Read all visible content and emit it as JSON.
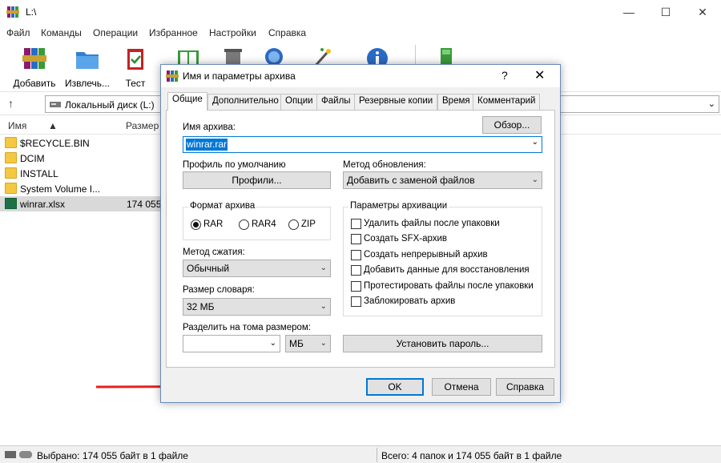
{
  "window": {
    "title": "L:\\"
  },
  "menu": [
    "Файл",
    "Команды",
    "Операции",
    "Избранное",
    "Настройки",
    "Справка"
  ],
  "toolbar": {
    "buttons": [
      "Добавить",
      "Извлечь...",
      "Тест"
    ]
  },
  "address": {
    "path": "Локальный диск (L:)"
  },
  "columns": {
    "name": "Имя",
    "size": "Размер"
  },
  "files": [
    {
      "name": "$RECYCLE.BIN",
      "size": "",
      "type": "folder"
    },
    {
      "name": "DCIM",
      "size": "",
      "type": "folder"
    },
    {
      "name": "INSTALL",
      "size": "",
      "type": "folder"
    },
    {
      "name": "System Volume I...",
      "size": "",
      "type": "folder"
    },
    {
      "name": "winrar.xlsx",
      "size": "174 055",
      "type": "xlsx"
    }
  ],
  "status": {
    "left": "Выбрано: 174 055 байт в 1 файле",
    "right": "Всего: 4 папок и 174 055 байт в 1 файле"
  },
  "dialog": {
    "title": "Имя и параметры архива",
    "help_glyph": "?",
    "tabs": [
      "Общие",
      "Дополнительно",
      "Опции",
      "Файлы",
      "Резервные копии",
      "Время",
      "Комментарий"
    ],
    "archive_name_label": "Имя архива:",
    "browse_button": "Обзор...",
    "archive_name_value": "winrar.rar",
    "default_profile_label": "Профиль по умолчанию",
    "profiles_button": "Профили...",
    "update_method_label": "Метод обновления:",
    "update_method_value": "Добавить с заменой файлов",
    "format_group": "Формат архива",
    "format_options": [
      "RAR",
      "RAR4",
      "ZIP"
    ],
    "format_selected": "RAR",
    "compression_label": "Метод сжатия:",
    "compression_value": "Обычный",
    "dict_label": "Размер словаря:",
    "dict_value": "32 МБ",
    "split_label": "Разделить на тома размером:",
    "split_value": "",
    "split_unit": "МБ",
    "options_group": "Параметры архивации",
    "options": [
      "Удалить файлы после упаковки",
      "Создать SFX-архив",
      "Создать непрерывный архив",
      "Добавить данные для восстановления",
      "Протестировать файлы после упаковки",
      "Заблокировать архив"
    ],
    "password_button": "Установить пароль...",
    "ok_button": "OK",
    "cancel_button": "Отмена",
    "help_button": "Справка"
  },
  "colors": {
    "accent": "#0078d7",
    "arrow": "#e8201c"
  }
}
